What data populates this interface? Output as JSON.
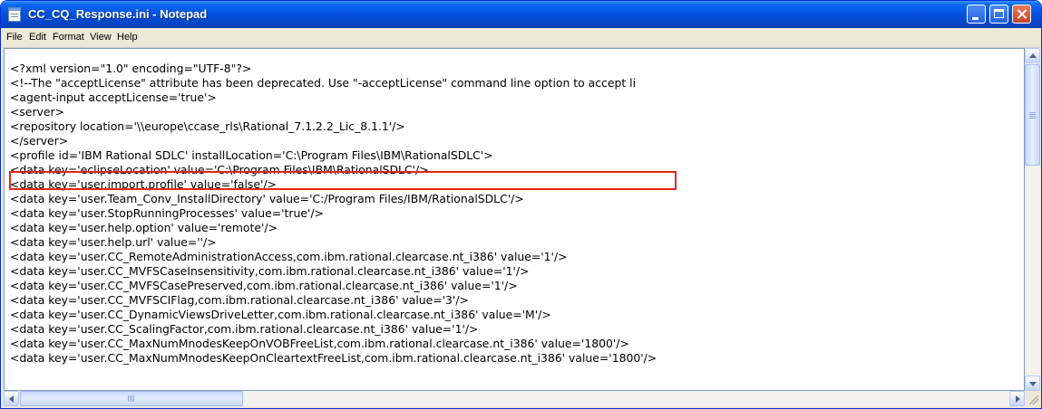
{
  "window": {
    "title": "CC_CQ_Response.ini - Notepad",
    "icon": "notepad-icon",
    "buttons": [
      "minimize-icon",
      "maximize-icon",
      "close-icon"
    ]
  },
  "menu": [
    "File",
    "Edit",
    "Format",
    "View",
    "Help"
  ],
  "lines": [
    "<?xml version=\"1.0\" encoding=\"UTF-8\"?>",
    "<!--The \"acceptLicense\" attribute has been deprecated. Use \"-acceptLicense\" command line option to accept li",
    "<agent-input acceptLicense='true'>",
    "<server>",
    "<repository location='\\\\europe\\ccase_rls\\Rational_7.1.2.2_Lic_8.1.1'/>",
    "</server>",
    "<profile id='IBM Rational SDLC' installLocation='C:\\Program Files\\IBM\\RationalSDLC'>",
    "<data key='eclipseLocation' value='C:\\Program Files\\IBM\\RationalSDLC'/>",
    "<data key='user.import.profile' value='false'/>",
    "<data key='user.Team_Conv_InstallDirectory' value='C:/Program Files/IBM/RationalSDLC'/>",
    "<data key='user.StopRunningProcesses' value='true'/>",
    "<data key='user.help.option' value='remote'/>",
    "<data key='user.help.url' value=''/>",
    "<data key='user.CC_RemoteAdministrationAccess,com.ibm.rational.clearcase.nt_i386' value='1'/>",
    "<data key='user.CC_MVFSCaseInsensitivity,com.ibm.rational.clearcase.nt_i386' value='1'/>",
    "<data key='user.CC_MVFSCasePreserved,com.ibm.rational.clearcase.nt_i386' value='1'/>",
    "<data key='user.CC_MVFSCIFlag,com.ibm.rational.clearcase.nt_i386' value='3'/>",
    "<data key='user.CC_DynamicViewsDriveLetter,com.ibm.rational.clearcase.nt_i386' value='M'/>",
    "<data key='user.CC_ScalingFactor,com.ibm.rational.clearcase.nt_i386' value='1'/>",
    "<data key='user.CC_MaxNumMnodesKeepOnVOBFreeList,com.ibm.rational.clearcase.nt_i386' value='1800'/>",
    "<data key='user.CC_MaxNumMnodesKeepOnCleartextFreeList,com.ibm.rational.clearcase.nt_i386' value='1800'/>"
  ],
  "highlight": {
    "line_number": 5,
    "color": "#e0261e"
  },
  "colors": {
    "titlebar": "#0553e0",
    "menubar": "#ece9d8",
    "editor_bg": "#ffffff"
  }
}
